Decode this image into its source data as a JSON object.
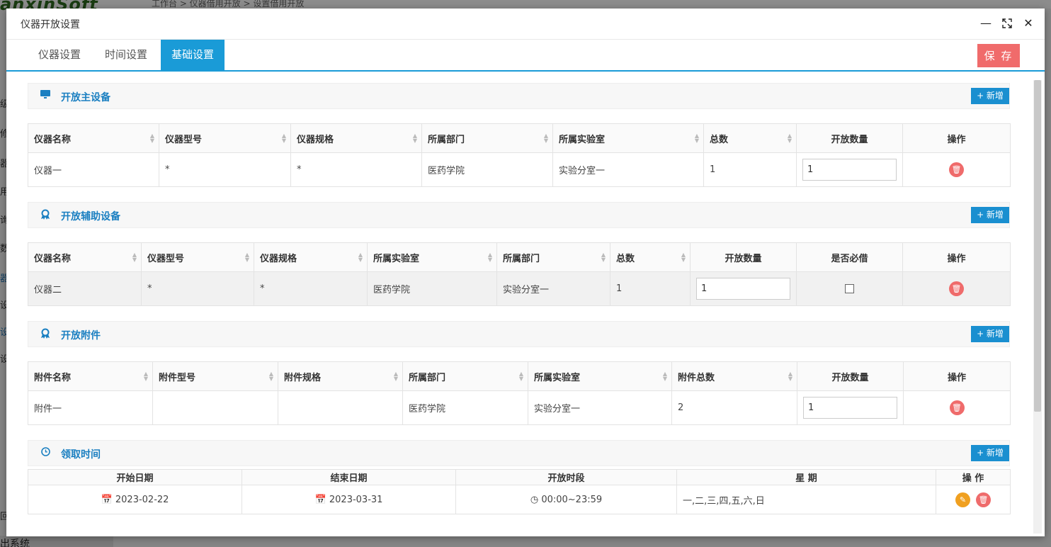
{
  "background": {
    "logo": "anxinSoft",
    "breadcrumb": "工作台 > 仪器借用开放 > 设置借用开放",
    "side_items": [
      "级",
      "修",
      "器",
      "用",
      "询",
      "数",
      "器",
      "设",
      "设",
      "设"
    ],
    "bottom_text": "出系统",
    "bottom_left": "回"
  },
  "dialog": {
    "title": "仪器开放设置",
    "tabs": [
      "仪器设置",
      "时间设置",
      "基础设置"
    ],
    "active_tab": "基础设置",
    "save_label": "保 存"
  },
  "add_label": "+ 新增",
  "main_equipment": {
    "title": "开放主设备",
    "icon": "monitor-icon",
    "columns": [
      "仪器名称",
      "仪器型号",
      "仪器规格",
      "所属部门",
      "所属实验室",
      "总数",
      "开放数量",
      "操作"
    ],
    "rows": [
      {
        "name": "仪器一",
        "model": "*",
        "spec": "*",
        "dept": "医药学院",
        "lab": "实验分室一",
        "total": "1",
        "open_qty": "1"
      }
    ]
  },
  "aux_equipment": {
    "title": "开放辅助设备",
    "icon": "award-icon",
    "columns": [
      "仪器名称",
      "仪器型号",
      "仪器规格",
      "所属实验室",
      "所属部门",
      "总数",
      "开放数量",
      "是否必借",
      "操作"
    ],
    "rows": [
      {
        "name": "仪器二",
        "model": "*",
        "spec": "*",
        "lab": "医药学院",
        "dept": "实验分室一",
        "total": "1",
        "open_qty": "1",
        "required": false
      }
    ]
  },
  "attachments": {
    "title": "开放附件",
    "icon": "award-icon",
    "columns": [
      "附件名称",
      "附件型号",
      "附件规格",
      "所属部门",
      "所属实验室",
      "附件总数",
      "开放数量",
      "操作"
    ],
    "rows": [
      {
        "name": "附件一",
        "model": "",
        "spec": "",
        "dept": "医药学院",
        "lab": "实验分室一",
        "total": "2",
        "open_qty": "1"
      }
    ]
  },
  "pickup_time": {
    "title": "领取时间",
    "icon": "clock-icon",
    "columns": [
      "开始日期",
      "结束日期",
      "开放时段",
      "星 期",
      "操 作"
    ],
    "rows": [
      {
        "start": "2023-02-22",
        "end": "2023-03-31",
        "period": "00:00~23:59",
        "weekdays": "一,二,三,四,五,六,日"
      }
    ]
  },
  "colors": {
    "accent": "#1a9bd7",
    "danger": "#f06b6b",
    "warning": "#f0a020"
  }
}
